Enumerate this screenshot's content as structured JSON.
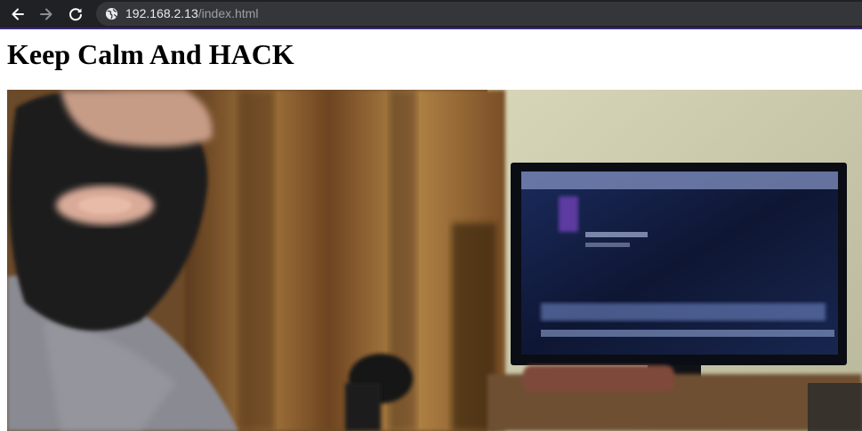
{
  "browser": {
    "url_host": "192.168.2.13",
    "url_path": "/index.html",
    "icons": {
      "back": "arrow-left-icon",
      "forward": "arrow-right-icon",
      "reload": "reload-icon",
      "site_info": "globe-icon"
    },
    "colors": {
      "toolbar_bg": "#202124",
      "omnibox_bg": "#35363a",
      "accent_line": "#3c2a78"
    }
  },
  "page": {
    "heading": "Keep Calm And HACK",
    "image": "photo-masked-hacker-at-computer"
  }
}
